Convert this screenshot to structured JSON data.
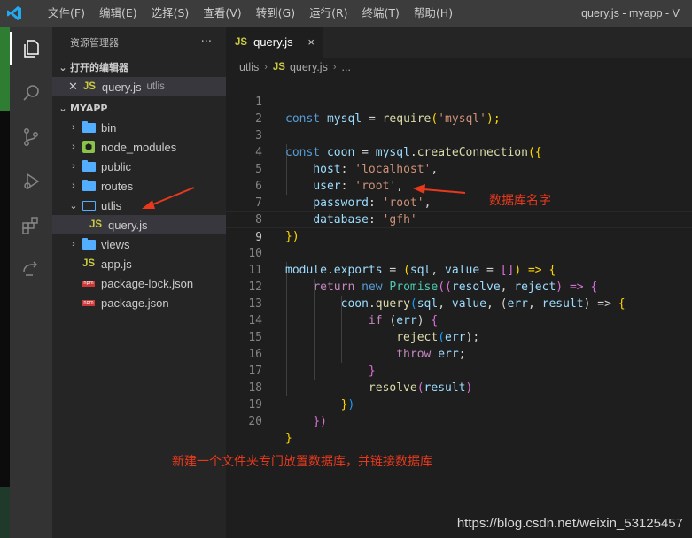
{
  "titlebar": {
    "menu": [
      "文件(F)",
      "编辑(E)",
      "选择(S)",
      "查看(V)",
      "转到(G)",
      "运行(R)",
      "终端(T)",
      "帮助(H)"
    ],
    "title": "query.js - myapp - V"
  },
  "activity_bar": [
    "explorer-icon",
    "search-icon",
    "source-control-icon",
    "run-debug-icon",
    "extensions-icon",
    "remote-icon"
  ],
  "sidebar": {
    "title": "资源管理器",
    "more": "···",
    "open_editors_label": "打开的编辑器",
    "open_editor": {
      "badge": "JS",
      "name": "query.js",
      "folder": "utlis"
    },
    "project_label": "MYAPP",
    "tree": [
      {
        "name": "bin"
      },
      {
        "name": "node_modules"
      },
      {
        "name": "public"
      },
      {
        "name": "routes"
      },
      {
        "name": "utlis"
      },
      {
        "name": "query.js"
      },
      {
        "name": "views"
      },
      {
        "name": "app.js"
      },
      {
        "name": "package-lock.json"
      },
      {
        "name": "package.json"
      }
    ]
  },
  "editor": {
    "tab": {
      "badge": "JS",
      "name": "query.js",
      "close": "×"
    },
    "breadcrumb": {
      "folder": "utlis",
      "badge": "JS",
      "file": "query.js",
      "more": "..."
    },
    "line_numbers": [
      "1",
      "2",
      "3",
      "4",
      "5",
      "6",
      "7",
      "8",
      "9",
      "10",
      "11",
      "12",
      "13",
      "14",
      "15",
      "16",
      "17",
      "18",
      "19",
      "20"
    ],
    "code": {
      "l1": [
        "const",
        "mysql",
        "=",
        "require",
        "(",
        "'mysql'",
        ");"
      ],
      "l3": [
        "const",
        "coon",
        "=",
        "mysql",
        ".",
        "createConnection",
        "({"
      ],
      "l4": [
        "host",
        ": ",
        "'localhost'",
        ","
      ],
      "l5": [
        "user",
        ": ",
        "'root'",
        ","
      ],
      "l6": [
        "password",
        ": ",
        "'root'",
        ","
      ],
      "l7": [
        "database",
        ": ",
        "'gfh'"
      ],
      "l8": [
        "}",
        ")"
      ],
      "l10": [
        "module",
        ".",
        "exports",
        " = ",
        "(",
        "sql",
        ", ",
        "value",
        " = ",
        "[]",
        ") => ",
        "{"
      ],
      "l11": [
        "return",
        "new",
        "Promise",
        "((",
        "resolve",
        ", ",
        "reject",
        ") => ",
        "{"
      ],
      "l12": [
        "coon",
        ".",
        "query",
        "(",
        "sql",
        ", ",
        "value",
        ", (",
        "err",
        ", ",
        "result",
        ") => ",
        "{"
      ],
      "l13": [
        "if",
        " (",
        "err",
        ") ",
        "{"
      ],
      "l14": [
        "reject",
        "(",
        "err",
        ");"
      ],
      "l15": [
        "throw",
        " ",
        "err",
        ";"
      ],
      "l16": [
        "}"
      ],
      "l17": [
        "resolve",
        "(",
        "result",
        ")"
      ],
      "l18": [
        "}",
        ")"
      ],
      "l19": [
        "}",
        ")"
      ],
      "l20": [
        "}"
      ]
    }
  },
  "annotations": {
    "db_name": "数据库名字",
    "folder_note": "新建一个文件夹专门放置数据库，并链接数据库"
  },
  "watermark": "https://blog.csdn.net/weixin_53125457"
}
